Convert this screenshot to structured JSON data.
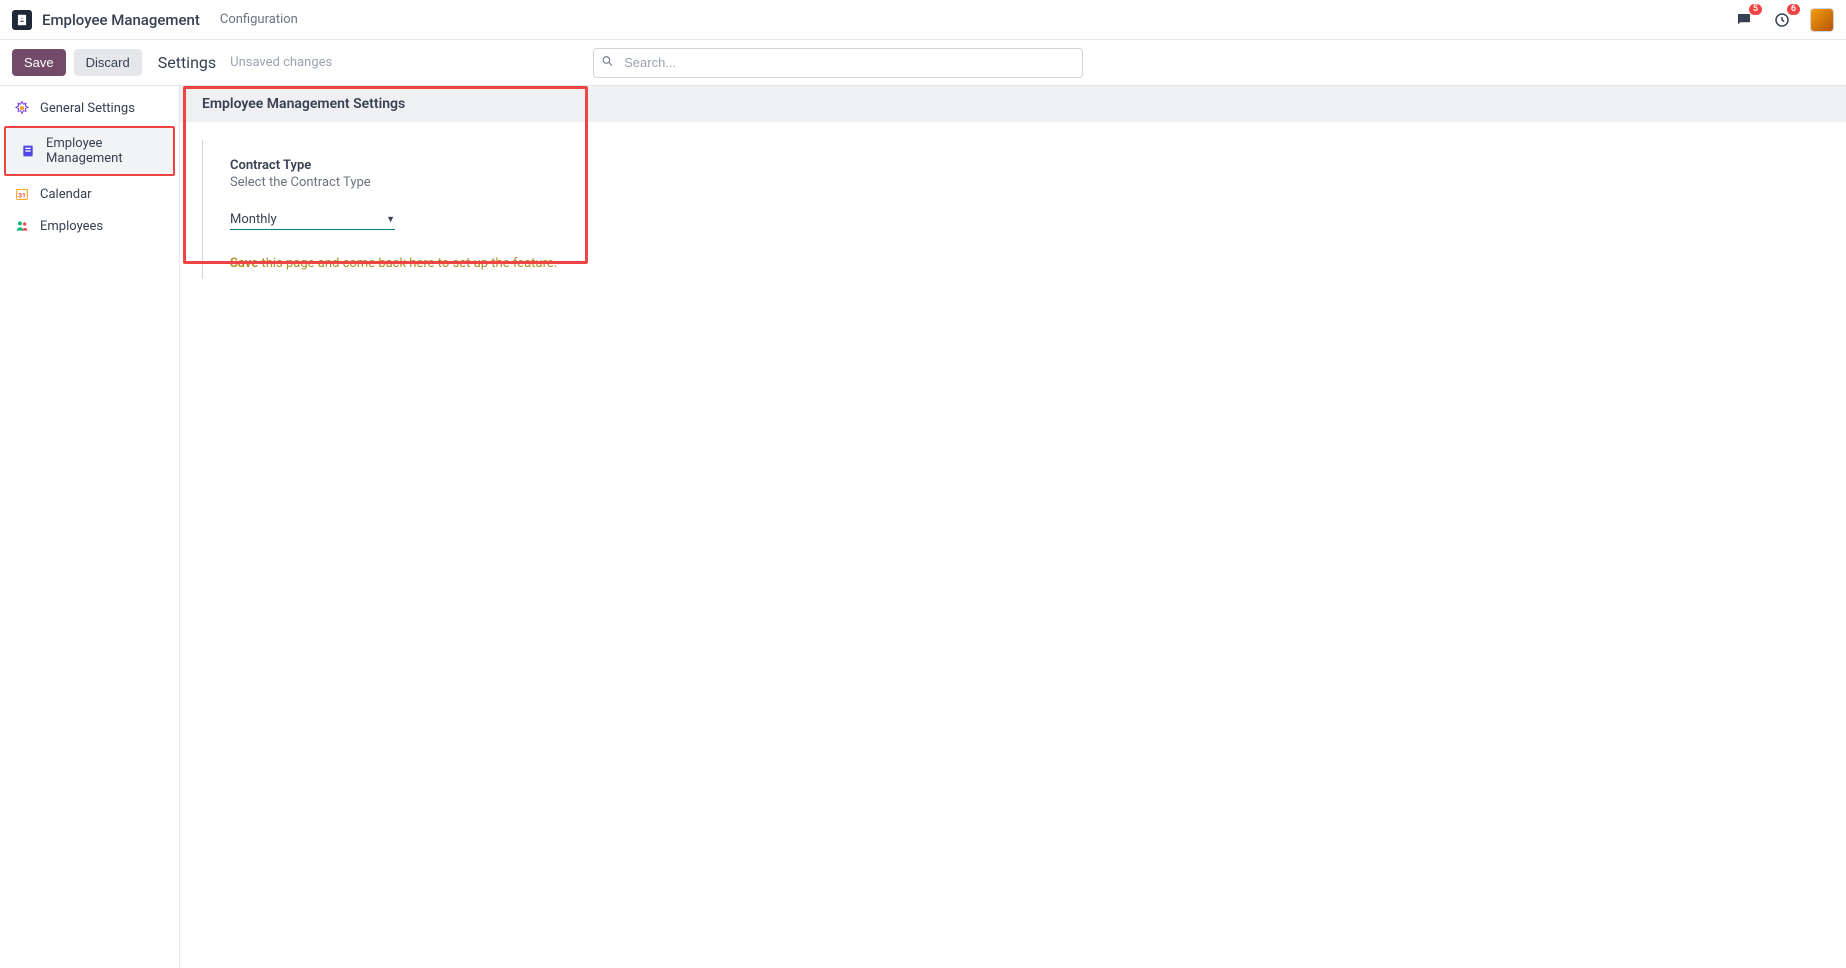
{
  "topbar": {
    "app_title": "Employee Management",
    "menu_configuration": "Configuration",
    "chat_badge": "5",
    "clock_badge": "6"
  },
  "actionbar": {
    "save_label": "Save",
    "discard_label": "Discard",
    "settings_label": "Settings",
    "unsaved_label": "Unsaved changes",
    "search_placeholder": "Search..."
  },
  "sidebar": {
    "items": [
      {
        "label": "General Settings"
      },
      {
        "label": "Employee Management"
      },
      {
        "label": "Calendar"
      },
      {
        "label": "Employees"
      }
    ]
  },
  "settings": {
    "section_title": "Employee Management Settings",
    "contract_type_label": "Contract Type",
    "contract_type_desc": "Select the Contract Type",
    "contract_type_value": "Monthly",
    "hint_save": "Save",
    "hint_rest": " this page and come back here to set up the feature."
  }
}
